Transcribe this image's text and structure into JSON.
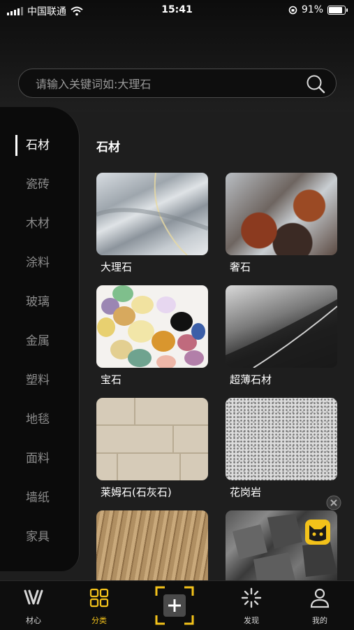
{
  "status_bar": {
    "carrier": "中国联通",
    "time": "15:41",
    "battery": "91%"
  },
  "search": {
    "placeholder": "请输入关键词如:大理石"
  },
  "sidebar": {
    "items": [
      {
        "label": "石材"
      },
      {
        "label": "瓷砖"
      },
      {
        "label": "木材"
      },
      {
        "label": "涂料"
      },
      {
        "label": "玻璃"
      },
      {
        "label": "金属"
      },
      {
        "label": "塑料"
      },
      {
        "label": "地毯"
      },
      {
        "label": "面料"
      },
      {
        "label": "墙纸"
      },
      {
        "label": "家具"
      }
    ]
  },
  "main": {
    "section_title": "石材",
    "materials": [
      {
        "label": "大理石"
      },
      {
        "label": "奢石"
      },
      {
        "label": "宝石"
      },
      {
        "label": "超薄石材"
      },
      {
        "label": "莱姆石(石灰石)"
      },
      {
        "label": "花岗岩"
      },
      {
        "label": ""
      },
      {
        "label": ""
      }
    ]
  },
  "tabbar": {
    "items": [
      {
        "label": "材心"
      },
      {
        "label": "分类"
      },
      {
        "label": "发现"
      },
      {
        "label": "我的"
      }
    ]
  },
  "colors": {
    "accent": "#f3c21a",
    "background": "#1e1e1e",
    "sidebar": "#0b0b0b"
  }
}
